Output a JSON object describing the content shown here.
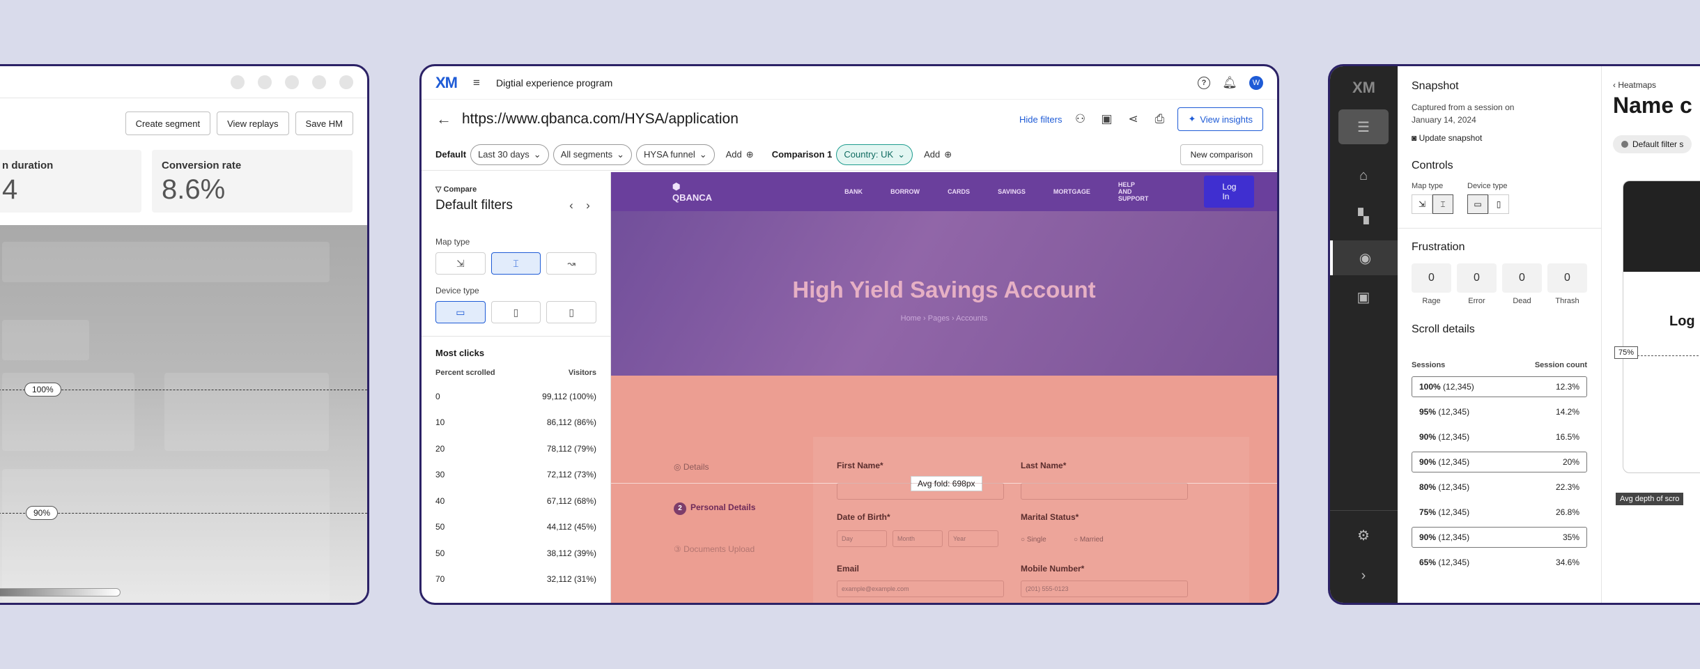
{
  "card1": {
    "buttons": {
      "create_segment": "Create segment",
      "view_replays": "View replays",
      "save_hm": "Save HM"
    },
    "kpis": [
      {
        "label": "n duration",
        "value": "4"
      },
      {
        "label": "Conversion rate",
        "value": "8.6%"
      }
    ],
    "markers": {
      "m100": "100%",
      "m90": "90%"
    }
  },
  "card2": {
    "program": "Digtial experience program",
    "url": "https://www.qbanca.com/HYSA/application",
    "hide_filters": "Hide filters",
    "view_insights": "View insights",
    "filters": {
      "default_label": "Default",
      "date": "Last 30 days",
      "segments": "All segments",
      "funnel": "HYSA funnel",
      "add": "Add",
      "comparison_label": "Comparison 1",
      "country": "Country: UK",
      "add2": "Add",
      "new_comparison": "New comparison"
    },
    "side": {
      "compare": "Compare",
      "title": "Default filters",
      "map_type": "Map type",
      "device_type": "Device type",
      "most_clicks": "Most clicks",
      "col_percent": "Percent scrolled",
      "col_visitors": "Visitors",
      "rows": [
        {
          "p": "0",
          "v": "99,112 (100%)"
        },
        {
          "p": "10",
          "v": "86,112 (86%)"
        },
        {
          "p": "20",
          "v": "78,112 (79%)"
        },
        {
          "p": "30",
          "v": "72,112 (73%)"
        },
        {
          "p": "40",
          "v": "67,112 (68%)"
        },
        {
          "p": "50",
          "v": "44,112 (45%)"
        },
        {
          "p": "50",
          "v": "38,112 (39%)"
        },
        {
          "p": "70",
          "v": "32,112 (31%)"
        }
      ]
    },
    "preview": {
      "brand": "QBANCA",
      "nav": [
        "BANK",
        "BORROW",
        "CARDS",
        "SAVINGS",
        "MORTGAGE",
        "HELP AND SUPPORT"
      ],
      "login": "Log In",
      "headline": "High Yield Savings Account",
      "breadcrumb": "Home  ›  Pages  ›  Accounts",
      "avg_fold": "Avg fold: 698px",
      "steps": [
        "Details",
        "Personal Details",
        "Documents Upload"
      ],
      "fields": {
        "first_name": "First Name*",
        "last_name": "Last Name*",
        "dob": "Date of Birth*",
        "marital": "Marital Status*",
        "email": "Email",
        "mobile": "Mobile Number*",
        "day": "Day",
        "month": "Month",
        "year": "Year",
        "single": "Single",
        "married": "Married",
        "email_ph": "example@example.com",
        "phone_ph": "(201) 555-0123"
      }
    }
  },
  "card3": {
    "logo": "XM",
    "snapshot": "Snapshot",
    "captured": "Captured from a session on January 14, 2024",
    "update": "Update snapshot",
    "controls": "Controls",
    "map_type": "Map type",
    "device_type": "Device type",
    "frustration": "Frustration",
    "frust": [
      {
        "v": "0",
        "l": "Rage"
      },
      {
        "v": "0",
        "l": "Error"
      },
      {
        "v": "0",
        "l": "Dead"
      },
      {
        "v": "0",
        "l": "Thrash"
      }
    ],
    "scroll_details": "Scroll details",
    "col_sessions": "Sessions",
    "col_count": "Session count",
    "scroll_rows": [
      {
        "p": "100%",
        "n": "(12,345)",
        "c": "12.3%",
        "boxed": true
      },
      {
        "p": "95%",
        "n": "(12,345)",
        "c": "14.2%",
        "boxed": false
      },
      {
        "p": "90%",
        "n": "(12,345)",
        "c": "16.5%",
        "boxed": false
      },
      {
        "p": "90%",
        "n": "(12,345)",
        "c": "20%",
        "boxed": true
      },
      {
        "p": "80%",
        "n": "(12,345)",
        "c": "22.3%",
        "boxed": false
      },
      {
        "p": "75%",
        "n": "(12,345)",
        "c": "26.8%",
        "boxed": false
      },
      {
        "p": "90%",
        "n": "(12,345)",
        "c": "35%",
        "boxed": true
      },
      {
        "p": "65%",
        "n": "(12,345)",
        "c": "34.6%",
        "boxed": false
      }
    ],
    "heatmaps_link": "Heatmaps",
    "name_title": "Name c",
    "default_filter": "Default filter s",
    "marker_75": "75%",
    "avg_depth": "Avg depth of scro",
    "preview_title": "Log"
  }
}
